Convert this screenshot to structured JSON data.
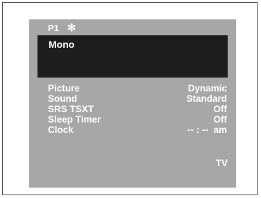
{
  "header": {
    "program": "P1",
    "icon": "asterisk-icon",
    "icon_glyph": "✻"
  },
  "banner": {
    "text": "Mono"
  },
  "menu": {
    "items": [
      {
        "label": "Picture",
        "value": "Dynamic"
      },
      {
        "label": "Sound",
        "value": "Standard"
      },
      {
        "label": "SRS TSXT",
        "value": "Off"
      },
      {
        "label": "Sleep Timer",
        "value": "Off"
      },
      {
        "label": "Clock",
        "value": "-- : --  am"
      }
    ]
  },
  "source": "TV",
  "colors": {
    "panel": "#a7a7a7",
    "banner": "#1d1d1d",
    "text": "#ffffff"
  }
}
